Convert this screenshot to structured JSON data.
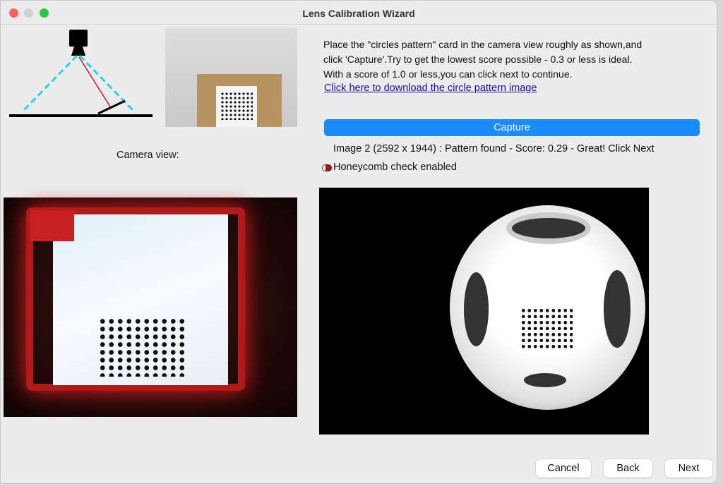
{
  "window": {
    "title": "Lens Calibration Wizard"
  },
  "instructions": {
    "line1": "Place the \"circles pattern\" card in the camera view roughly as shown,and",
    "line2": "click 'Capture'.Try to get the lowest score possible - 0.3 or less is ideal.",
    "line3": "With a score of 1.0 or less,you can click next to continue.",
    "download_link": "Click here to download the circle pattern image"
  },
  "capture_label": "Capture",
  "status": "Image 2 (2592 x 1944) : Pattern found - Score: 0.29 - Great! Click Next",
  "honeycomb": {
    "label": "Honeycomb check enabled",
    "enabled": true
  },
  "camera_view_label": "Camera view:",
  "buttons": {
    "cancel": "Cancel",
    "back": "Back",
    "next": "Next"
  },
  "colors": {
    "accent": "#1a8cff",
    "link": "#1a0dab"
  }
}
